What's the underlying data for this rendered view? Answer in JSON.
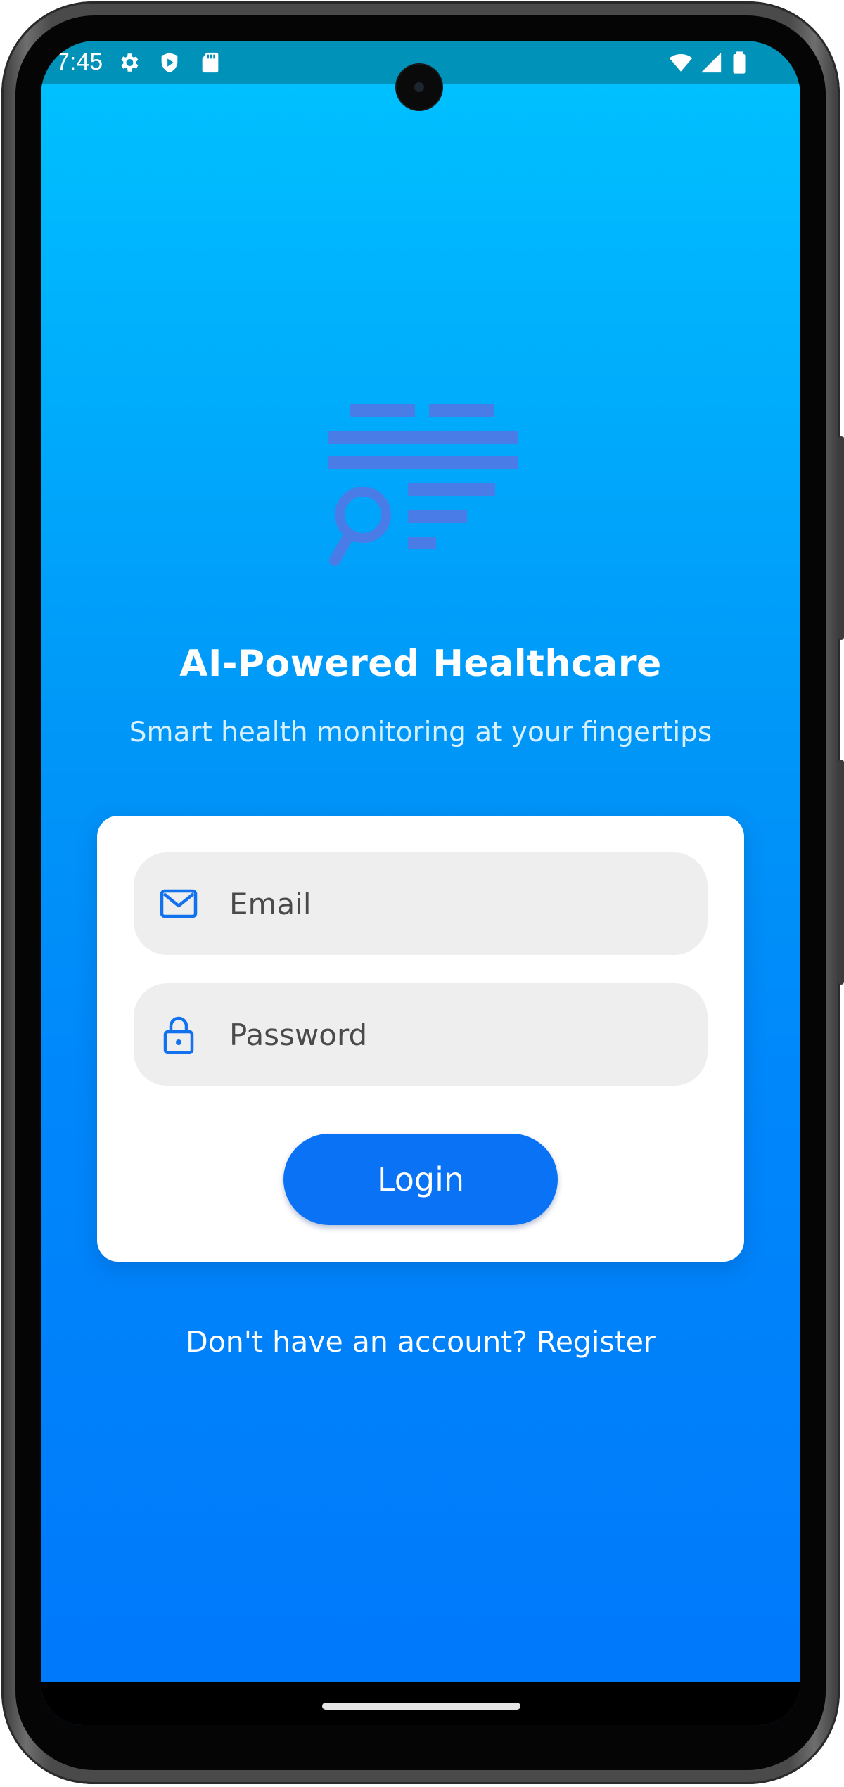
{
  "status_bar": {
    "time": "7:45",
    "left_icons": [
      "settings-icon",
      "shield-play-icon",
      "sd-card-icon"
    ],
    "right_icons": [
      "wifi-icon",
      "signal-icon",
      "battery-icon"
    ]
  },
  "app": {
    "title": "AI-Powered Healthcare",
    "subtitle": "Smart health monitoring at your fingertips",
    "logo_icon": "health-search-logo-icon"
  },
  "login_form": {
    "email_placeholder": "Email",
    "email_value": "",
    "email_icon": "mail-icon",
    "password_placeholder": "Password",
    "password_value": "",
    "password_icon": "lock-icon",
    "login_label": "Login"
  },
  "register_link": "Don't have an account? Register",
  "colors": {
    "gradient_top": "#00c0ff",
    "gradient_bottom": "#0078fb",
    "status_bar": "#0092b8",
    "primary_button": "#0a72f5",
    "logo": "#4a7ce8",
    "field_background": "#eeeeee",
    "card_background": "#ffffff"
  }
}
